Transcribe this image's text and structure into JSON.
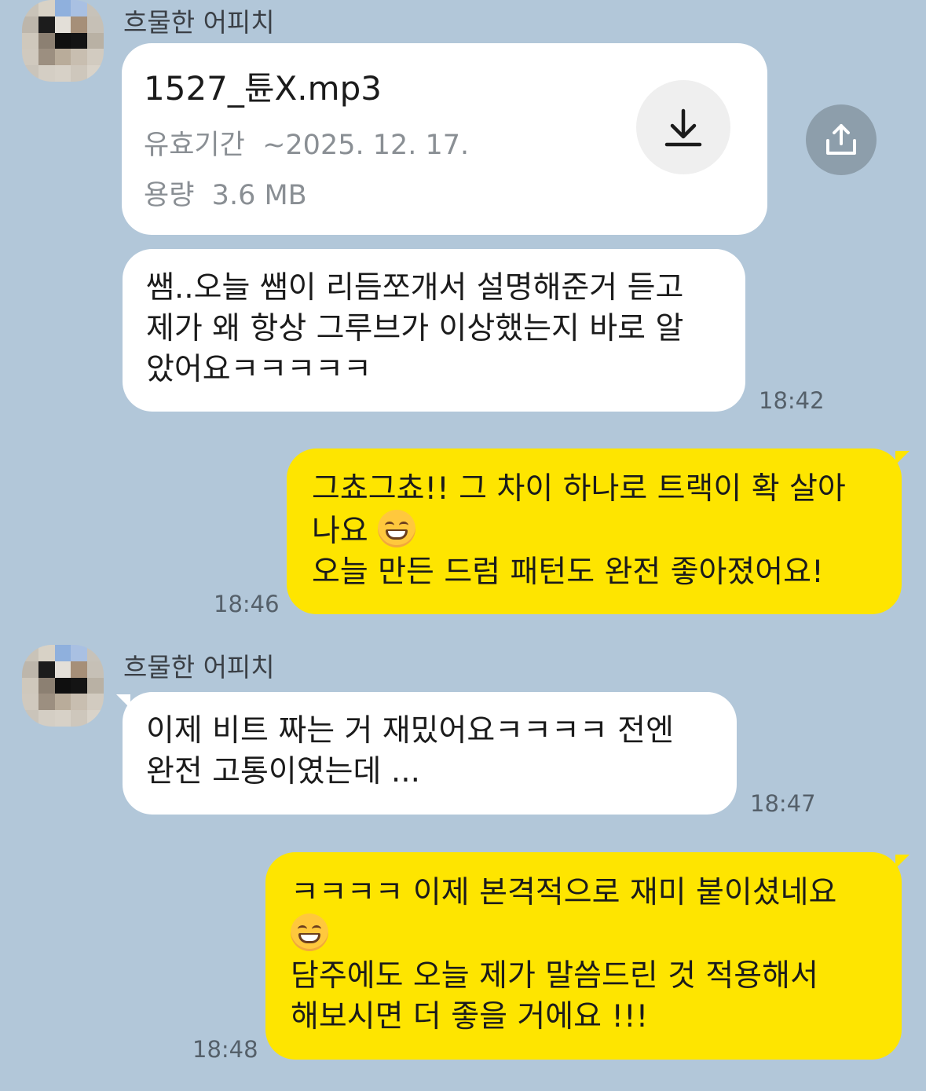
{
  "sender": {
    "name": "흐물한 어피치"
  },
  "file_message": {
    "filename": "1527_튠X.mp3",
    "expiry_label": "유효기간",
    "expiry_value": "~2025. 12. 17.",
    "size_label": "용량",
    "size_value": "3.6 MB",
    "download_icon": "download-icon",
    "share_icon": "share-icon"
  },
  "messages": [
    {
      "from": "other",
      "lines": [
        "쌤..오늘 쌤이 리듬쪼개서 설명해준거 듣고",
        "제가 왜 항상 그루브가 이상했는지 바로 알",
        "았어요ㅋㅋㅋㅋㅋ"
      ],
      "time": "18:42"
    },
    {
      "from": "me",
      "lines": [
        "그쵸그쵸!! 그 차이 하나로 트랙이 확 살아",
        "나요",
        "오늘 만든 드럼 패턴도 완전 좋아졌어요!"
      ],
      "time": "18:46"
    },
    {
      "from": "other",
      "lines": [
        "이제 비트 짜는 거 재밌어요ㅋㅋㅋㅋ 전엔",
        "완전 고통이였는데 ..."
      ],
      "time": "18:47"
    },
    {
      "from": "me",
      "lines": [
        "ㅋㅋㅋㅋ 이제 본격적으로 재미 붙이셨네요",
        "",
        "담주에도 오늘 제가 말씀드린 것 적용해서",
        "해보시면 더 좋을 거에요 !!!"
      ],
      "time": "18:48"
    }
  ],
  "colors": {
    "background": "#b2c7d9",
    "my_bubble": "#fee500",
    "other_bubble": "#ffffff"
  }
}
